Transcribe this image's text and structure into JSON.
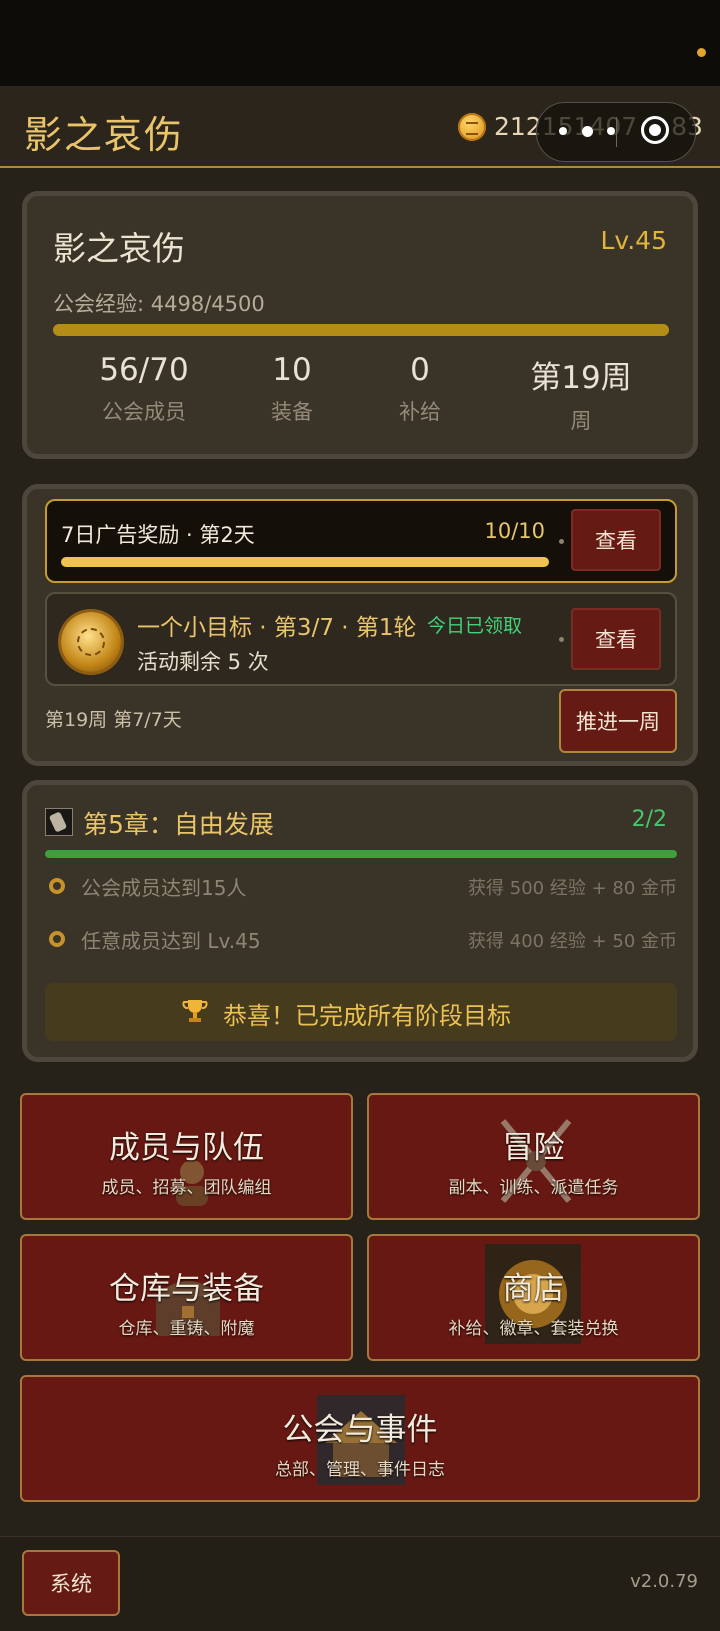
{
  "header": {
    "title": "影之哀伤",
    "gold": "212151407",
    "gold_tail": "83",
    "coin_icon": "coin-icon"
  },
  "guild": {
    "name": "影之哀伤",
    "level": "Lv.45",
    "exp_label": "公会经验: 4498/4500",
    "exp_fraction": 0.9996,
    "stats": [
      {
        "value": "56/70",
        "label": "公会成员"
      },
      {
        "value": "10",
        "label": "装备"
      },
      {
        "value": "0",
        "label": "补给"
      },
      {
        "value": "第19周",
        "label": "周"
      }
    ]
  },
  "activity": {
    "ad": {
      "title": "7日广告奖励 · 第2天",
      "progress": "10/10",
      "fraction": 1.0,
      "button": "查看"
    },
    "goal": {
      "title": "一个小目标 · 第3/7 · 第1轮",
      "claimed": "今日已领取",
      "remaining": "活动剩余 5 次",
      "button": "查看"
    },
    "week_info": "第19周 第7/7天",
    "advance_button": "推进一周"
  },
  "chapter": {
    "title": "第5章：自由发展",
    "progress": "2/2",
    "tasks": [
      {
        "name": "公会成员达到15人",
        "reward": "获得 500 经验 + 80 金币"
      },
      {
        "name": "任意成员达到 Lv.45",
        "reward": "获得 400 经验 + 50 金币"
      }
    ],
    "congrats": "恭喜！已完成所有阶段目标"
  },
  "menu": {
    "members": {
      "title": "成员与队伍",
      "sub": "成员、招募、团队编组"
    },
    "adventure": {
      "title": "冒险",
      "sub": "副本、训练、派遣任务"
    },
    "warehouse": {
      "title": "仓库与装备",
      "sub": "仓库、重铸、附魔"
    },
    "shop": {
      "title": "商店",
      "sub": "补给、徽章、套装兑换"
    },
    "guild": {
      "title": "公会与事件",
      "sub": "总部、管理、事件日志"
    }
  },
  "footer": {
    "system_button": "系统",
    "version": "v2.0.79"
  },
  "colors": {
    "accent_gold": "#e9c46a",
    "menu_red": "#681812",
    "success_green": "#49c56e"
  }
}
